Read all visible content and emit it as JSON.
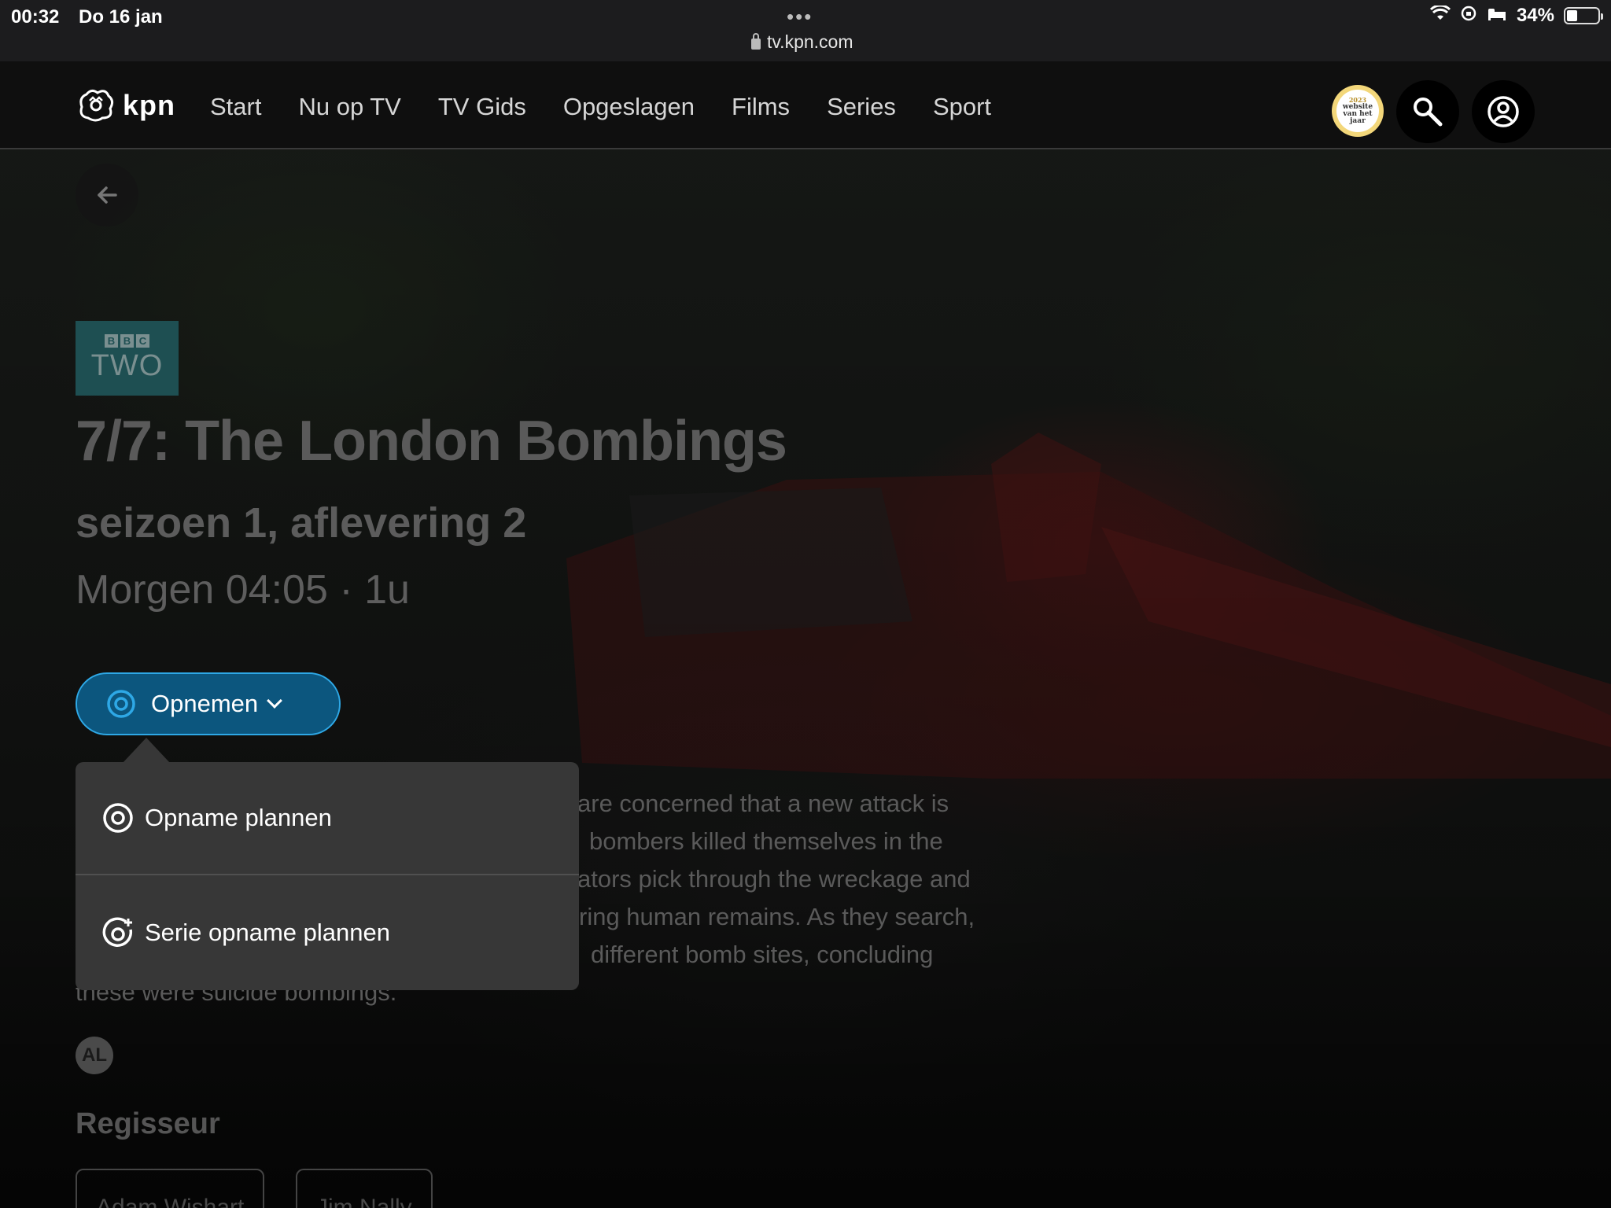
{
  "status_bar": {
    "time": "00:32",
    "date": "Do 16 jan",
    "url": "tv.kpn.com",
    "battery": "34%",
    "battery_level": 0.34
  },
  "nav": {
    "logo_text": "kpn",
    "links": [
      "Start",
      "Nu op TV",
      "TV Gids",
      "Opgeslagen",
      "Films",
      "Series",
      "Sport"
    ],
    "award_lines": [
      "2023",
      "website",
      "van het",
      "jaar"
    ],
    "icons": [
      "search-icon",
      "account-icon"
    ]
  },
  "program": {
    "channel_boxes": [
      "B",
      "B",
      "C"
    ],
    "channel_name": "TWO",
    "title": "7/7: The London Bombings",
    "episode": "seizoen 1, aflevering 2",
    "airtime": "Morgen 04:05 · 1u",
    "record_label": "Opnemen",
    "description_lines": [
      "are concerned that a new attack is",
      "bombers killed themselves in the",
      "ators pick through the wreckage and",
      "ring human remains. As they search,",
      "different bomb sites, concluding",
      "these were suicide bombings."
    ],
    "rating": "AL",
    "director_heading": "Regisseur",
    "directors": [
      "Adam Wishart",
      "Jim Nally"
    ]
  },
  "dropdown": {
    "items": [
      {
        "label": "Opname plannen",
        "icon": "record-icon"
      },
      {
        "label": "Serie opname plannen",
        "icon": "series-record-icon"
      }
    ]
  },
  "colors": {
    "accent": "#2ea8e6",
    "record_button_bg": "#0c567e",
    "dropdown_bg": "#373737",
    "nav_bg": "#0f0f0f"
  }
}
